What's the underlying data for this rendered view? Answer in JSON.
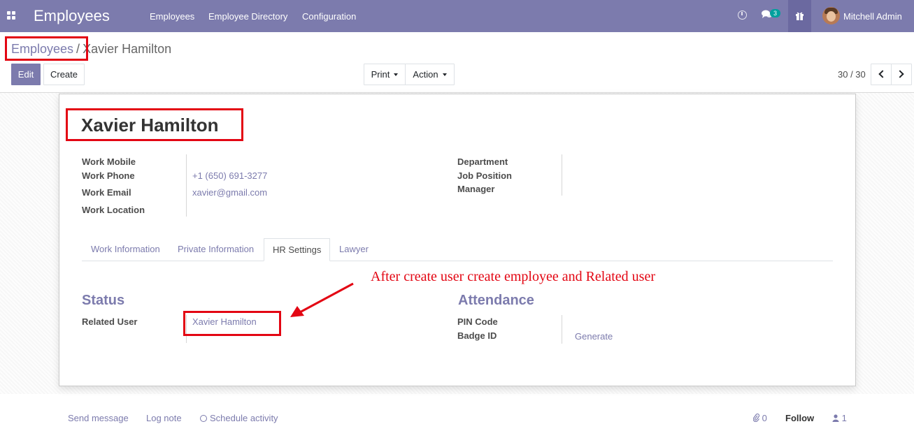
{
  "navbar": {
    "app_title": "Employees",
    "menu": [
      "Employees",
      "Employee Directory",
      "Configuration"
    ],
    "chat_badge": "3",
    "user_name": "Mitchell Admin",
    "icons": [
      "apps-grid-icon",
      "clock-icon",
      "chat-icon",
      "gift-icon"
    ]
  },
  "breadcrumb": {
    "parent": "Employees",
    "separator": "/",
    "current": "Xavier Hamilton"
  },
  "toolbar": {
    "edit_label": "Edit",
    "create_label": "Create",
    "print_label": "Print",
    "action_label": "Action",
    "pager": "30 / 30"
  },
  "employee": {
    "name": "Xavier Hamilton",
    "fields_left": [
      {
        "label": "Work Mobile",
        "value": ""
      },
      {
        "label": "Work Phone",
        "value": "+1 (650) 691-3277"
      },
      {
        "label": "Work Email",
        "value": "xavier@gmail.com"
      },
      {
        "label": "Work Location",
        "value": ""
      }
    ],
    "fields_right": [
      {
        "label": "Department",
        "value": ""
      },
      {
        "label": "Job Position",
        "value": ""
      },
      {
        "label": "Manager",
        "value": ""
      }
    ]
  },
  "tabs": [
    "Work Information",
    "Private Information",
    "HR Settings",
    "Lawyer"
  ],
  "active_tab": "HR Settings",
  "annotation": "After create user create employee and Related user",
  "hr_settings": {
    "status_title": "Status",
    "related_user_label": "Related User",
    "related_user_value": "Xavier Hamilton",
    "attendance_title": "Attendance",
    "pin_code_label": "PIN Code",
    "badge_id_label": "Badge ID",
    "generate_label": "Generate"
  },
  "chatter": {
    "send_message": "Send message",
    "log_note": "Log note",
    "schedule_activity": "Schedule activity",
    "attachments_count": "0",
    "follow_label": "Follow",
    "followers_count": "1"
  },
  "colors": {
    "brand": "#7c7bad",
    "annotation_red": "#e30613"
  }
}
